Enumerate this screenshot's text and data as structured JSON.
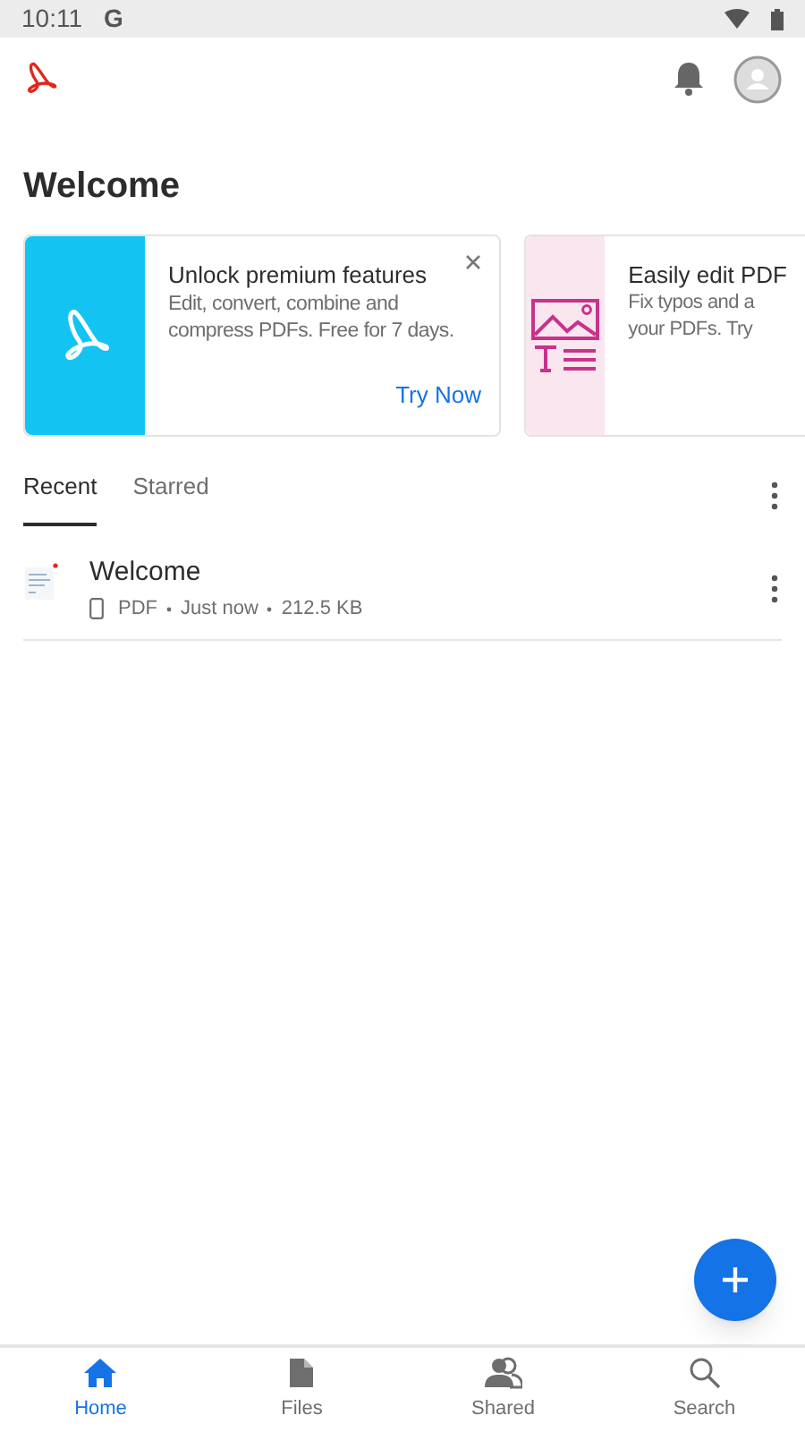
{
  "status_bar": {
    "time": "10:11",
    "app_letter": "G"
  },
  "heading": "Welcome",
  "cards": [
    {
      "kind": "acrobat",
      "title": "Unlock premium features",
      "body": "Edit, convert, combine and compress PDFs. Free for 7 days.",
      "action": "Try Now",
      "closable": true
    },
    {
      "kind": "edit",
      "title": "Easily edit PDF",
      "body_lines": [
        "Fix typos and a",
        "your PDFs. Try"
      ],
      "closable": false
    }
  ],
  "tabs": [
    {
      "label": "Recent",
      "selected": true
    },
    {
      "label": "Starred",
      "selected": false
    }
  ],
  "files": [
    {
      "name": "Welcome",
      "type": "PDF",
      "time": "Just now",
      "size": "212.5 KB"
    }
  ],
  "nav": [
    {
      "label": "Home",
      "kind": "home",
      "selected": true
    },
    {
      "label": "Files",
      "kind": "file",
      "selected": false
    },
    {
      "label": "Shared",
      "kind": "people",
      "selected": false
    },
    {
      "label": "Search",
      "kind": "search",
      "selected": false
    }
  ]
}
